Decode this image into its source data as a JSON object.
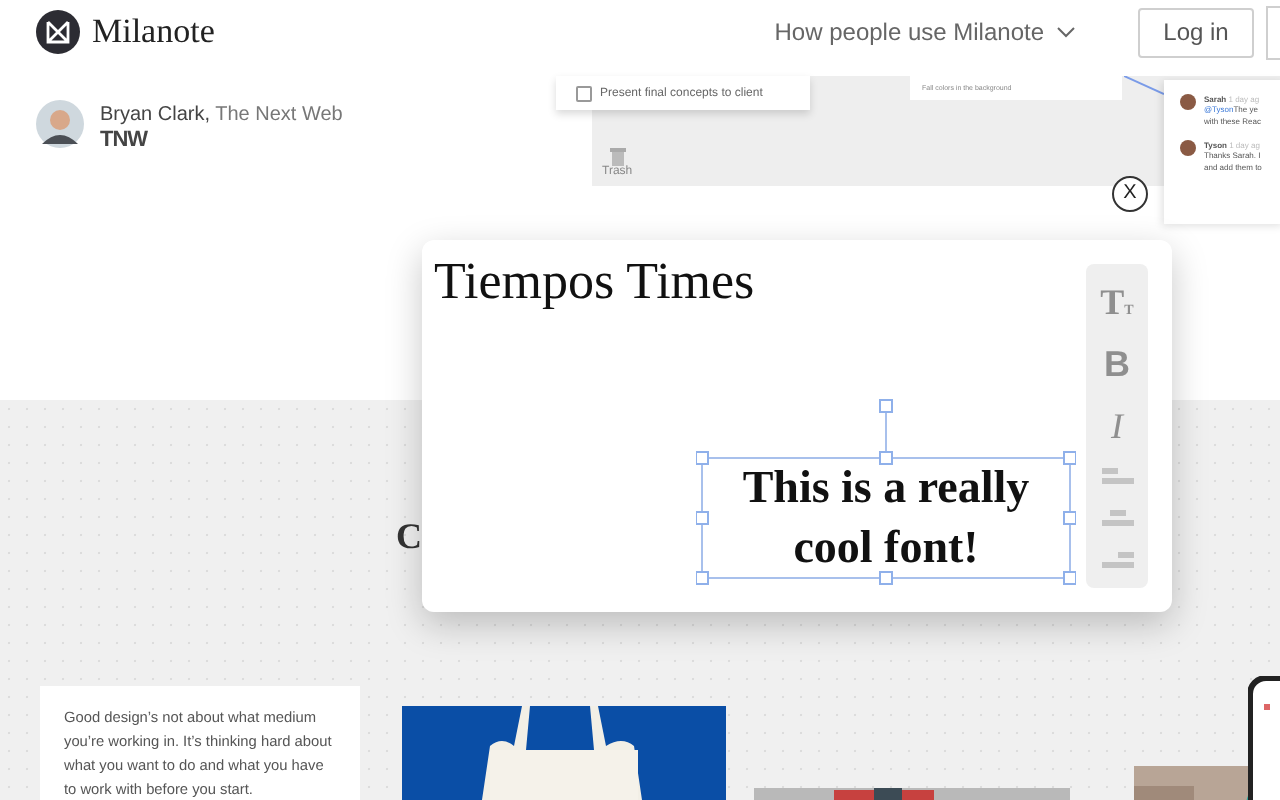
{
  "header": {
    "logo": "Milanote",
    "nav": [
      {
        "label": "How people use Milanote",
        "dropdown": true
      }
    ],
    "buttons": [
      "Log in"
    ]
  },
  "testimonial": {
    "byline": "**Bryan Clark,** The Next Web",
    "publication_logo": "TNW"
  },
  "preview": {
    "task": {
      "label": "Present final concepts to client",
      "checked": false
    },
    "note": "Fall colors in the background",
    "trash_label": "Trash",
    "comments": [
      {
        "author": "Sarah",
        "time": "1 day ag",
        "mention": "@Tyson",
        "lines": [
          "The ye",
          "with these Reac"
        ]
      },
      {
        "author": "Tyson",
        "time": "1 day ag",
        "lines": [
          "Thanks Sarah. I",
          "and add them to"
        ]
      }
    ]
  },
  "close_label": "X",
  "section_heading": "C",
  "font_demo": {
    "font_name": "Tiempos Times",
    "sample": "This is a really cool font!",
    "tools": [
      {
        "kind": "size",
        "label": "T",
        "small_label": "T"
      },
      {
        "kind": "bold",
        "label": "B"
      },
      {
        "kind": "italic",
        "label": "I"
      },
      {
        "kind": "align-left"
      },
      {
        "kind": "align-center"
      },
      {
        "kind": "align-right"
      }
    ]
  },
  "quote": "Good design’s not about what medium you’re working in. It’s thinking hard about what you want to do and what you have to work with before you start."
}
